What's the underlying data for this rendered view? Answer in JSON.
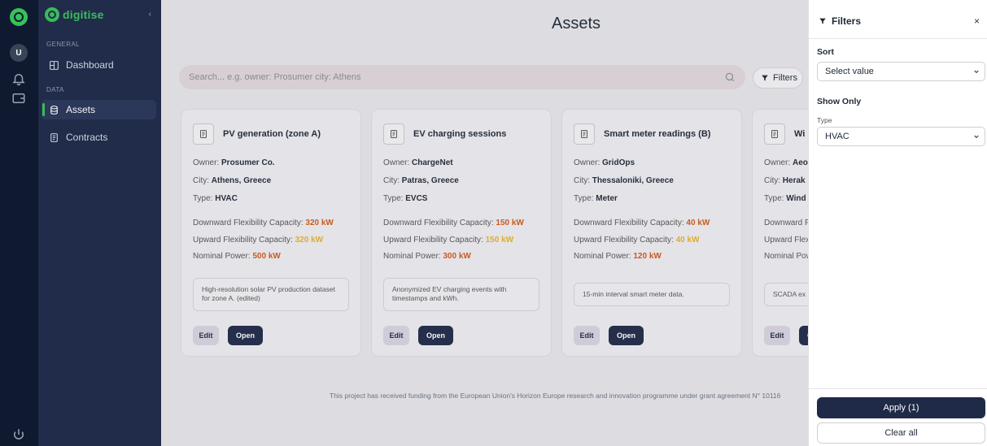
{
  "rail": {
    "avatar_initial": "U"
  },
  "brand": {
    "name": "digitise"
  },
  "sidebar": {
    "section_general": "GENERAL",
    "section_data": "DATA",
    "items": [
      {
        "label": "Dashboard"
      },
      {
        "label": "Assets"
      },
      {
        "label": "Contracts"
      }
    ]
  },
  "main": {
    "title": "Assets",
    "search_placeholder": "Search... e.g. owner: Prosumer city: Athens",
    "filters_label": "Filters"
  },
  "card_labels": {
    "owner": "Owner:",
    "city": "City:",
    "type": "Type:",
    "down": "Downward Flexibility Capacity:",
    "up": "Upward Flexibility Capacity:",
    "nominal": "Nominal Power:",
    "edit": "Edit",
    "open": "Open"
  },
  "cards": [
    {
      "title": "PV generation (zone A)",
      "owner": "Prosumer Co.",
      "city": "Athens, Greece",
      "type": "HVAC",
      "down": "320 kW",
      "up": "320 kW",
      "nominal": "500 kW",
      "description": "High-resolution solar PV production dataset for zone A. (edited)"
    },
    {
      "title": "EV charging sessions",
      "owner": "ChargeNet",
      "city": "Patras, Greece",
      "type": "EVCS",
      "down": "150 kW",
      "up": "150 kW",
      "nominal": "300 kW",
      "description": "Anonymized EV charging events with timestamps and kWh."
    },
    {
      "title": "Smart meter readings (B)",
      "owner": "GridOps",
      "city": "Thessaloniki, Greece",
      "type": "Meter",
      "down": "40 kW",
      "up": "40 kW",
      "nominal": "120 kW",
      "description": "15-min interval smart meter data."
    },
    {
      "title": "Wi",
      "owner": "Aeo",
      "city": "Herak",
      "type": "Wind",
      "down": "",
      "up": "",
      "nominal": "",
      "down_label": "Downward Fl",
      "up_label": "Upward Flexi",
      "nominal_label": "Nominal Pow",
      "description": "SCADA ex"
    }
  ],
  "footer": {
    "text": "This project has received funding from the European Union's Horizon Europe research and innovation programme under grant agreement N° 10116"
  },
  "filters_panel": {
    "title": "Filters",
    "close": "×",
    "sort_label": "Sort",
    "sort_value": "Select value",
    "show_only_label": "Show Only",
    "type_label": "Type",
    "type_value": "HVAC",
    "apply_label": "Apply (1)",
    "clear_label": "Clear all"
  },
  "colors": {
    "accent": "#36c25a",
    "navy": "#1f2a48",
    "sidebar": "#1a2745",
    "rail": "#0f1a30",
    "warn_red": "#d05a1a",
    "warn_yellow": "#e5b22a"
  }
}
